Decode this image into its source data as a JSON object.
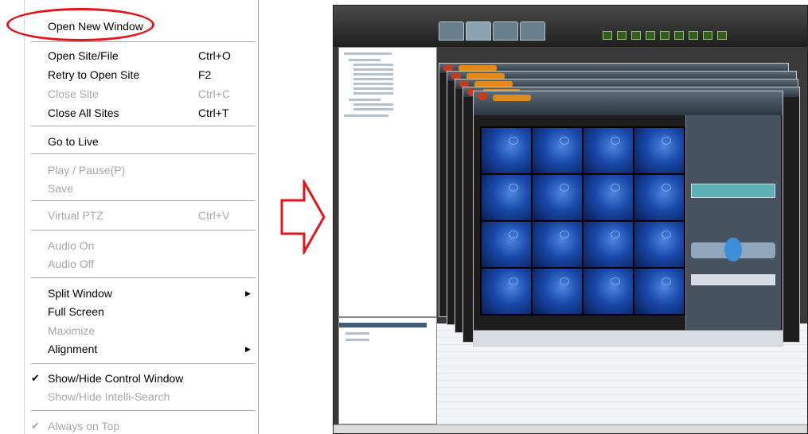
{
  "menu": {
    "items": [
      {
        "label": "Open New Window",
        "shortcut": "",
        "enabled": true,
        "submenu": false,
        "checked": false
      },
      {
        "label": "Open Site/File",
        "shortcut": "Ctrl+O",
        "enabled": true,
        "submenu": false,
        "checked": false
      },
      {
        "label": "Retry to Open Site",
        "shortcut": "F2",
        "enabled": true,
        "submenu": false,
        "checked": false
      },
      {
        "label": "Close Site",
        "shortcut": "Ctrl+C",
        "enabled": false,
        "submenu": false,
        "checked": false
      },
      {
        "label": "Close All Sites",
        "shortcut": "Ctrl+T",
        "enabled": true,
        "submenu": false,
        "checked": false
      },
      {
        "label": "Go to Live",
        "shortcut": "",
        "enabled": true,
        "submenu": false,
        "checked": false
      },
      {
        "label": "Play / Pause(P)",
        "shortcut": "",
        "enabled": false,
        "submenu": false,
        "checked": false
      },
      {
        "label": "Save",
        "shortcut": "",
        "enabled": false,
        "submenu": false,
        "checked": false
      },
      {
        "label": "Virtual PTZ",
        "shortcut": "Ctrl+V",
        "enabled": false,
        "submenu": false,
        "checked": false
      },
      {
        "label": "Audio On",
        "shortcut": "",
        "enabled": false,
        "submenu": false,
        "checked": false
      },
      {
        "label": "Audio Off",
        "shortcut": "",
        "enabled": false,
        "submenu": false,
        "checked": false
      },
      {
        "label": "Split Window",
        "shortcut": "",
        "enabled": true,
        "submenu": true,
        "checked": false
      },
      {
        "label": "Full Screen",
        "shortcut": "",
        "enabled": true,
        "submenu": false,
        "checked": false
      },
      {
        "label": "Maximize",
        "shortcut": "",
        "enabled": false,
        "submenu": false,
        "checked": false
      },
      {
        "label": "Alignment",
        "shortcut": "",
        "enabled": true,
        "submenu": true,
        "checked": false
      },
      {
        "label": "Show/Hide Control Window",
        "shortcut": "",
        "enabled": true,
        "submenu": false,
        "checked": true
      },
      {
        "label": "Show/Hide Intelli-Search",
        "shortcut": "",
        "enabled": false,
        "submenu": false,
        "checked": false
      },
      {
        "label": "Always on Top",
        "shortcut": "",
        "enabled": false,
        "submenu": false,
        "checked": true
      }
    ],
    "highlight_color": "#e4141b",
    "check_glyph": "✔",
    "submenu_glyph": "▶"
  },
  "arrow": {
    "color": "#e4141b",
    "icon": "right-arrow-outline-icon"
  },
  "app_screenshot": {
    "video_color": "#1848a8",
    "viewer_title_color": "#e08a1a"
  }
}
